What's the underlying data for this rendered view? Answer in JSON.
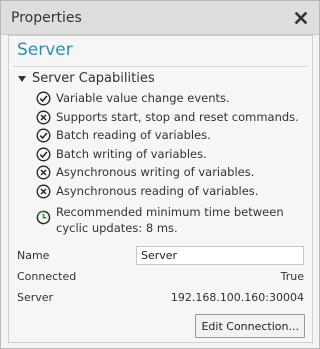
{
  "window": {
    "title": "Properties"
  },
  "panel": {
    "heading": "Server",
    "group_label": "Server Capabilities",
    "capabilities": [
      {
        "status": "supported",
        "icon": "check-circle-icon",
        "label": "Variable value change events."
      },
      {
        "status": "unsupported",
        "icon": "x-circle-icon",
        "label": "Supports start, stop and reset commands."
      },
      {
        "status": "supported",
        "icon": "check-circle-icon",
        "label": "Batch reading of variables."
      },
      {
        "status": "supported",
        "icon": "check-circle-icon",
        "label": "Batch writing of variables."
      },
      {
        "status": "unsupported",
        "icon": "x-circle-icon",
        "label": "Asynchronous writing of variables."
      },
      {
        "status": "unsupported",
        "icon": "x-circle-icon",
        "label": "Asynchronous reading of variables."
      },
      {
        "status": "info",
        "icon": "clock-icon",
        "label": "Recommended minimum time between cyclic updates: 8 ms."
      }
    ],
    "fields": {
      "name_label": "Name",
      "name_value": "Server",
      "connected_label": "Connected",
      "connected_value": "True",
      "server_label": "Server",
      "server_value": "192.168.100.160:30004"
    },
    "edit_button": "Edit Connection..."
  },
  "colors": {
    "heading": "#2c8fb0",
    "clock_accent": "#1a8f2a"
  }
}
